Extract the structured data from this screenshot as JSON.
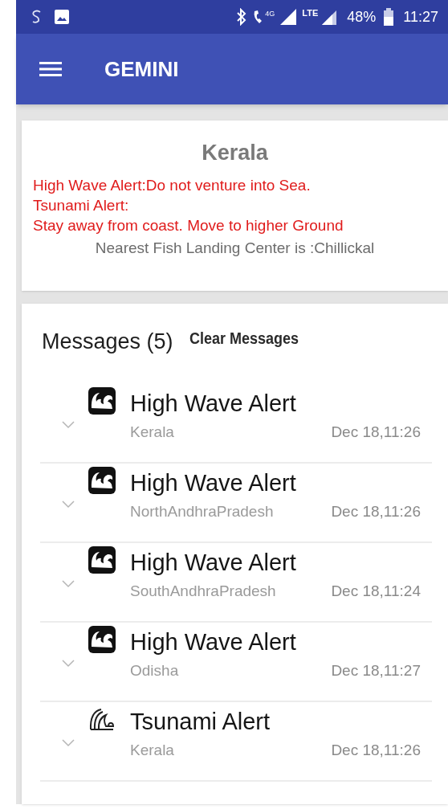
{
  "status_bar": {
    "call_label": "4G",
    "network_label": "LTE",
    "battery": "48%",
    "time": "11:27"
  },
  "app_bar": {
    "title": "GEMINI"
  },
  "region_card": {
    "title": "Kerala",
    "alerts": [
      "High Wave Alert:Do not venture into Sea.",
      "Tsunami Alert:",
      "Stay away from coast. Move to higher Ground"
    ],
    "note": "Nearest Fish Landing Center is :Chillickal"
  },
  "messages": {
    "heading": "Messages (5)",
    "clear_button": "Clear Messages",
    "items": [
      {
        "kind": "high_wave",
        "title": "High Wave Alert",
        "region": "Kerala",
        "time": "Dec 18,11:26"
      },
      {
        "kind": "high_wave",
        "title": "High Wave Alert",
        "region": "NorthAndhraPradesh",
        "time": "Dec 18,11:26"
      },
      {
        "kind": "high_wave",
        "title": "High Wave Alert",
        "region": "SouthAndhraPradesh",
        "time": "Dec 18,11:24"
      },
      {
        "kind": "high_wave",
        "title": "High Wave Alert",
        "region": "Odisha",
        "time": "Dec 18,11:27"
      },
      {
        "kind": "tsunami",
        "title": "Tsunami Alert",
        "region": "Kerala",
        "time": "Dec 18,11:26"
      }
    ]
  }
}
